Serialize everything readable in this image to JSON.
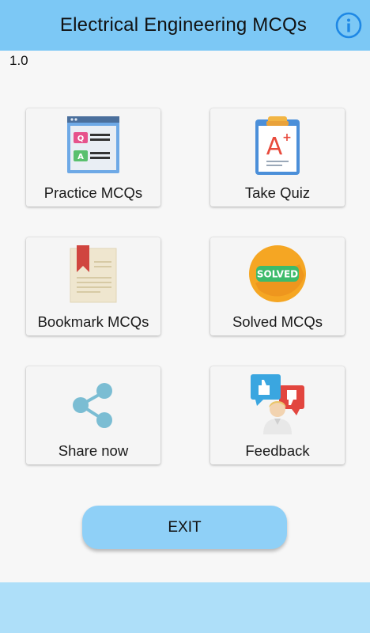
{
  "app": {
    "title": "Electrical Engineering MCQs",
    "version": "1.0",
    "info_icon": "info-icon"
  },
  "menu": [
    {
      "label": "Practice MCQs",
      "icon": "qa-document-icon"
    },
    {
      "label": "Take Quiz",
      "icon": "clipboard-grade-icon"
    },
    {
      "label": "Bookmark MCQs",
      "icon": "bookmark-page-icon"
    },
    {
      "label": "Solved MCQs",
      "icon": "solved-badge-icon",
      "badge_text": "SOLVED"
    },
    {
      "label": "Share now",
      "icon": "share-icon"
    },
    {
      "label": "Feedback",
      "icon": "feedback-thumbs-icon"
    }
  ],
  "exit_label": "EXIT",
  "colors": {
    "appbar": "#7cc8f5",
    "exit_button": "#8fd0f7",
    "bottom_bar": "#aedff9",
    "info_icon": "#1e88e5"
  }
}
